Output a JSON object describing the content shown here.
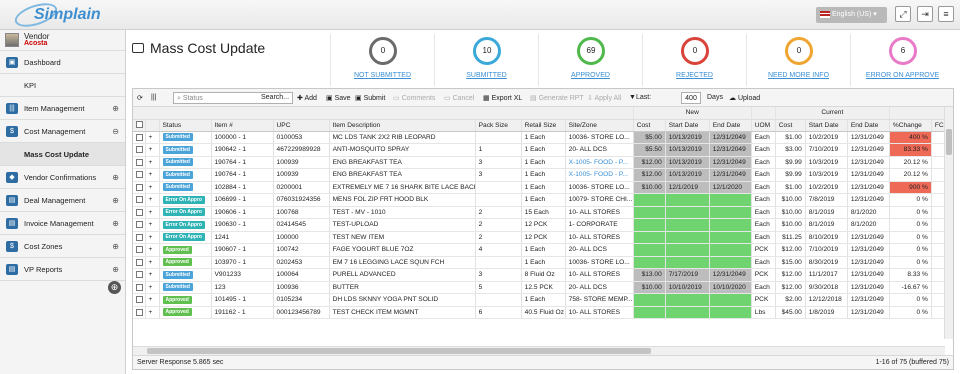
{
  "app": {
    "logo_text": "Simplain",
    "language": "English (US)",
    "language_arrow": "▾"
  },
  "user": {
    "name": "Vendor",
    "surname": "Acosta"
  },
  "sidebar": {
    "items": [
      {
        "label": "Dashboard",
        "icon": "▣",
        "expand": ""
      },
      {
        "label": "KPI",
        "icon": "",
        "expand": ""
      },
      {
        "label": "Item Management",
        "icon": "|||",
        "expand": "⊕"
      },
      {
        "label": "Cost Management",
        "icon": "$",
        "expand": "⊖"
      },
      {
        "label": "Mass Cost Update",
        "icon": "",
        "expand": ""
      },
      {
        "label": "Vendor Confirmations",
        "icon": "◆",
        "expand": "⊕"
      },
      {
        "label": "Deal Management",
        "icon": "▤",
        "expand": "⊕"
      },
      {
        "label": "Invoice Management",
        "icon": "▤",
        "expand": "⊕"
      },
      {
        "label": "Cost Zones",
        "icon": "$",
        "expand": "⊕"
      },
      {
        "label": "VP Reports",
        "icon": "▤",
        "expand": "⊕"
      }
    ]
  },
  "page": {
    "title": "Mass Cost Update"
  },
  "stats": [
    {
      "count": "0",
      "label": "NOT SUBMITTED",
      "color": "#6b6b6b",
      "text_color": "#3a8fd6"
    },
    {
      "count": "10",
      "label": "SUBMITTED",
      "color": "#3aa9d9",
      "text_color": "#3a8fd6"
    },
    {
      "count": "69",
      "label": "APPROVED",
      "color": "#4fb84a",
      "text_color": "#3a8fd6"
    },
    {
      "count": "0",
      "label": "REJECTED",
      "color": "#d9433a",
      "text_color": "#3a8fd6"
    },
    {
      "count": "0",
      "label": "NEED MORE INFO",
      "color": "#f0a532",
      "text_color": "#3a8fd6"
    },
    {
      "count": "6",
      "label": "ERROR ON APPROVE",
      "color": "#e87ac8",
      "text_color": "#3a8fd6"
    }
  ],
  "toolbar": {
    "search_placeholder": "Status",
    "search_btn": "Search...",
    "add": "Add",
    "save": "Save",
    "submit": "Submit",
    "comments": "Comments",
    "cancel": "Cancel",
    "export": "Export XL",
    "generate": "Generate RPT",
    "apply_all": "Apply All",
    "last_label": "Last:",
    "days_value": "400",
    "days_label": "Days",
    "upload": "Upload"
  },
  "table": {
    "group_new": "New",
    "group_current": "Current",
    "columns": [
      "",
      "",
      "Status",
      "Item #",
      "UPC",
      "Item Description",
      "Pack Size",
      "Retail Size",
      "Site/Zone",
      "Cost",
      "Start Date",
      "End Date",
      "UOM",
      "Cost",
      "Start Date",
      "End Date",
      "%Change",
      "FCC"
    ],
    "rows": [
      {
        "status": "Submitted",
        "st": "sub",
        "item": "100000 - 1",
        "upc": "0100053",
        "desc": "MC LDS TANK 2X2 RIB LEOPARD",
        "pack": "",
        "retail": "1 Each",
        "site": "10036- STORE LO...",
        "ncost": "$5.00",
        "nstart": "10/13/2019",
        "nend": "12/31/2049",
        "uom": "Each",
        "ccost": "$1.00",
        "cstart": "10/2/2019",
        "cend": "12/31/2049",
        "pct": "400 %",
        "pctc": "red",
        "link": false,
        "green": false
      },
      {
        "status": "Submitted",
        "st": "sub",
        "item": "190642 - 1",
        "upc": "467229989928",
        "desc": "ANTI-MOSQUITO SPRAY",
        "pack": "1",
        "retail": "1 Each",
        "site": "20- ALL DCS",
        "ncost": "$5.50",
        "nstart": "10/13/2019",
        "nend": "12/31/2049",
        "uom": "Each",
        "ccost": "$3.00",
        "cstart": "7/10/2019",
        "cend": "12/31/2049",
        "pct": "83.33 %",
        "pctc": "red",
        "link": false,
        "green": false
      },
      {
        "status": "Submitted",
        "st": "sub",
        "item": "190764 - 1",
        "upc": "100939",
        "desc": "ENG BREAKFAST TEA",
        "pack": "3",
        "retail": "1 Each",
        "site": "X-1005- FOOD - P...",
        "ncost": "$12.00",
        "nstart": "10/13/2019",
        "nend": "12/31/2049",
        "uom": "Each",
        "ccost": "$9.99",
        "cstart": "10/3/2019",
        "cend": "12/31/2049",
        "pct": "20.12 %",
        "pctc": "",
        "link": true,
        "green": false
      },
      {
        "status": "Submitted",
        "st": "sub",
        "item": "190764 - 1",
        "upc": "100939",
        "desc": "ENG BREAKFAST TEA",
        "pack": "3",
        "retail": "1 Each",
        "site": "X-1005- FOOD - P...",
        "ncost": "$12.00",
        "nstart": "10/13/2019",
        "nend": "12/31/2049",
        "uom": "Each",
        "ccost": "$9.99",
        "cstart": "10/3/2019",
        "cend": "12/31/2049",
        "pct": "20.12 %",
        "pctc": "",
        "link": true,
        "green": false
      },
      {
        "status": "Submitted",
        "st": "sub",
        "item": "102884 - 1",
        "upc": "0200001",
        "desc": "EXTREMELY ME 7 16 SHARK BITE LACE BACK",
        "pack": "",
        "retail": "1 Each",
        "site": "10036- STORE LO...",
        "ncost": "$10.00",
        "nstart": "12/1/2019",
        "nend": "12/1/2020",
        "uom": "Each",
        "ccost": "$1.00",
        "cstart": "10/2/2019",
        "cend": "12/31/2049",
        "pct": "900 %",
        "pctc": "red",
        "link": false,
        "green": false
      },
      {
        "status": "Error On Appro",
        "st": "err",
        "item": "106699 - 1",
        "upc": "076031924356",
        "desc": "MENS FOL ZIP FRT HOOD BLK",
        "pack": "",
        "retail": "1 Each",
        "site": "10079- STORE CHI...",
        "ncost": "",
        "nstart": "",
        "nend": "",
        "uom": "Each",
        "ccost": "$10.00",
        "cstart": "7/8/2019",
        "cend": "12/31/2049",
        "pct": "0 %",
        "pctc": "",
        "link": false,
        "green": true
      },
      {
        "status": "Error On Appro",
        "st": "err",
        "item": "190606 - 1",
        "upc": "100768",
        "desc": "TEST - MV - 1010",
        "pack": "2",
        "retail": "15 Each",
        "site": "10- ALL STORES",
        "ncost": "",
        "nstart": "",
        "nend": "",
        "uom": "Each",
        "ccost": "$10.00",
        "cstart": "8/1/2019",
        "cend": "8/1/2020",
        "pct": "0 %",
        "pctc": "",
        "link": false,
        "green": true
      },
      {
        "status": "Error On Appro",
        "st": "err",
        "item": "190630 - 1",
        "upc": "02414545",
        "desc": "TEST-UPLOAD",
        "pack": "2",
        "retail": "12 PCK",
        "site": "1- CORPORATE",
        "ncost": "",
        "nstart": "",
        "nend": "",
        "uom": "Each",
        "ccost": "$10.00",
        "cstart": "8/1/2019",
        "cend": "8/1/2020",
        "pct": "0 %",
        "pctc": "",
        "link": false,
        "green": true
      },
      {
        "status": "Error On Appro",
        "st": "err",
        "item": "1241",
        "upc": "100000",
        "desc": "TEST NEW ITEM",
        "pack": "2",
        "retail": "12 PCK",
        "site": "10- ALL STORES",
        "ncost": "",
        "nstart": "",
        "nend": "",
        "uom": "Each",
        "ccost": "$11.25",
        "cstart": "8/10/2019",
        "cend": "12/31/2049",
        "pct": "0 %",
        "pctc": "",
        "link": false,
        "green": true
      },
      {
        "status": "Approved",
        "st": "app",
        "item": "190607 - 1",
        "upc": "100742",
        "desc": "FAGE YOGURT BLUE 7OZ",
        "pack": "4",
        "retail": "1 Each",
        "site": "20- ALL DCS",
        "ncost": "",
        "nstart": "",
        "nend": "",
        "uom": "PCK",
        "ccost": "$12.00",
        "cstart": "7/10/2019",
        "cend": "12/31/2049",
        "pct": "0 %",
        "pctc": "",
        "link": false,
        "green": true
      },
      {
        "status": "Approved",
        "st": "app",
        "item": "103970 - 1",
        "upc": "0202453",
        "desc": "EM 7 16 LEGGING LACE SQUN FCH",
        "pack": "",
        "retail": "1 Each",
        "site": "10036- STORE LO...",
        "ncost": "",
        "nstart": "",
        "nend": "",
        "uom": "Each",
        "ccost": "$15.00",
        "cstart": "8/30/2019",
        "cend": "12/31/2049",
        "pct": "0 %",
        "pctc": "",
        "link": false,
        "green": true
      },
      {
        "status": "Submitted",
        "st": "sub",
        "item": "V901233",
        "upc": "100064",
        "desc": "PURELL ADVANCED",
        "pack": "3",
        "retail": "8 Fluid Oz",
        "site": "10- ALL STORES",
        "ncost": "$13.00",
        "nstart": "7/17/2019",
        "nend": "12/31/2049",
        "uom": "PCK",
        "ccost": "$12.00",
        "cstart": "11/1/2017",
        "cend": "12/31/2049",
        "pct": "8.33 %",
        "pctc": "",
        "link": false,
        "green": false
      },
      {
        "status": "Submitted",
        "st": "sub",
        "item": "123",
        "upc": "100936",
        "desc": "BUTTER",
        "pack": "5",
        "retail": "12.5 PCK",
        "site": "20- ALL DCS",
        "ncost": "$10.00",
        "nstart": "10/10/2019",
        "nend": "10/10/2020",
        "uom": "Each",
        "ccost": "$12.00",
        "cstart": "9/30/2018",
        "cend": "12/31/2049",
        "pct": "-16.67 %",
        "pctc": "",
        "link": false,
        "green": false
      },
      {
        "status": "Approved",
        "st": "app",
        "item": "101495 - 1",
        "upc": "0105234",
        "desc": "DH LDS SKNNY YOGA PNT SOLID",
        "pack": "",
        "retail": "1 Each",
        "site": "758- STORE MEMP...",
        "ncost": "",
        "nstart": "",
        "nend": "",
        "uom": "PCK",
        "ccost": "$2.00",
        "cstart": "12/12/2018",
        "cend": "12/31/2049",
        "pct": "0 %",
        "pctc": "",
        "link": false,
        "green": true
      },
      {
        "status": "Approved",
        "st": "app",
        "item": "191162 - 1",
        "upc": "000123456789",
        "desc": "TEST CHECK ITEM MGMNT",
        "pack": "6",
        "retail": "40.5 Fluid Oz",
        "site": "10- ALL STORES",
        "ncost": "",
        "nstart": "",
        "nend": "",
        "uom": "Lbs",
        "ccost": "$45.00",
        "cstart": "1/8/2019",
        "cend": "12/31/2049",
        "pct": "0 %",
        "pctc": "",
        "link": false,
        "green": true
      }
    ]
  },
  "footer": {
    "response": "Server Response 5.865 sec",
    "paging": "1-16 of 75 (buffered 75)"
  }
}
